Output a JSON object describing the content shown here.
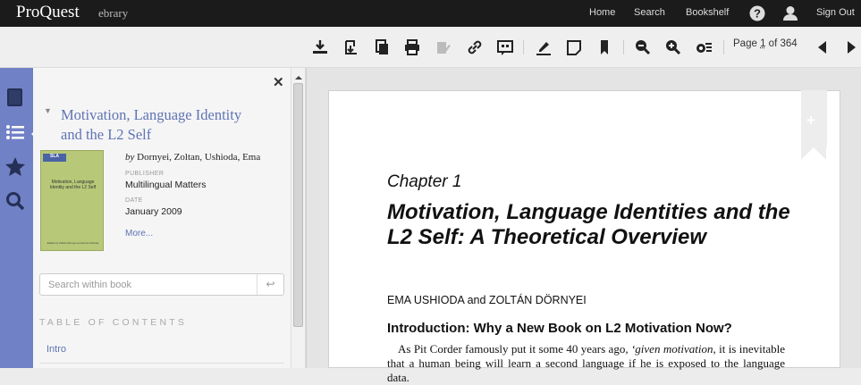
{
  "header": {
    "logo": "ProQuest",
    "product": "ebrary",
    "nav": [
      "Home",
      "Search",
      "Bookshelf"
    ],
    "sign_out": "Sign Out",
    "icons": [
      "help-icon",
      "user-icon"
    ]
  },
  "toolbar": {
    "icons": [
      "download-icon",
      "download-chapter-icon",
      "copy-icon",
      "print-icon",
      "highlight-icon",
      "link-icon",
      "citation-icon",
      "annotate-icon",
      "note-icon",
      "bookmark-icon",
      "zoom-out-icon",
      "zoom-in-icon",
      "page-settings-icon"
    ],
    "page_label": "Page",
    "page_current": "1",
    "page_of": "of 364",
    "prev_icon": "prev-page-icon",
    "next_icon": "next-page-icon"
  },
  "sidebar": {
    "rail": [
      "book-icon",
      "list-icon",
      "star-icon",
      "search-icon"
    ],
    "book": {
      "title": "Motivation, Language Identity and the L2 Self",
      "by_prefix": "by",
      "authors": "Dornyei, Zoltan, Ushioda, Ema",
      "publisher_label": "PUBLISHER",
      "publisher": "Multilingual Matters",
      "date_label": "DATE",
      "date": "January 2009",
      "more": "More...",
      "cover": {
        "series": "SLA",
        "title": "Motivation, Language Identity and the L2 Self",
        "footer": "Edited by Zoltán Dörnyei and Ema Ushioda"
      }
    },
    "search_placeholder": "Search within book",
    "toc_heading": "TABLE OF CONTENTS",
    "toc": [
      "Intro"
    ]
  },
  "document": {
    "chapter": "Chapter 1",
    "title": "Motivation, Language Identities and the L2 Self: A Theoretical Overview",
    "authors": "EMA USHIODA and ZOLTÁN DÖRNYEI",
    "section": "Introduction: Why a New Book on L2 Motivation Now?",
    "para_start": "As Pit Corder famously put it some 40 years ago, ",
    "para_italic": "‘given motivation",
    "para_end": ", it is inevitable that a human being will learn a second language if he is exposed to the language data."
  },
  "colors": {
    "accent": "#5f73b5",
    "rail": "#7181c6",
    "topbar": "#1b1b1b"
  }
}
